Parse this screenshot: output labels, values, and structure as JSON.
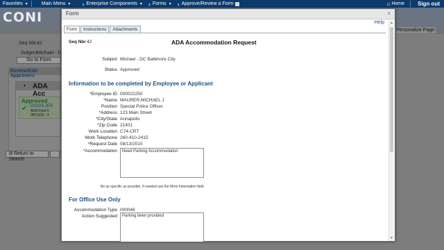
{
  "topnav": {
    "items": [
      "Favorites",
      "Main Menu",
      "Enterprise Components",
      "Forms",
      "Approve/Review a Form"
    ],
    "home": "Home",
    "signout": "Sign out"
  },
  "background": {
    "logo_text": "CONI",
    "seq_label": "Seq Nbr",
    "seq_value": "42",
    "subject_label": "Subject",
    "subject_value": "Michael - DC",
    "go_to_form": "Go to Form",
    "review_header": "Review/Edit Approvers",
    "card_title": "ADA Acc",
    "approved": "Approved",
    "approver_name": "DIGGS,JER",
    "approver_role": "ADA Field C",
    "approver_date": "08/13/15 - 4",
    "return_search": "Return to Search",
    "personalize": "Personalize Page"
  },
  "modal": {
    "title": "Form",
    "close": "×",
    "help": "Help",
    "tabs": [
      "Form",
      "Instructions",
      "Attachments"
    ],
    "seq_label": "Seq Nbr",
    "seq_value": "42",
    "form_title": "ADA Accommodation Request",
    "subject_label": "Subject",
    "subject_value": "Michael - DC Baltimore City",
    "status_label": "Status",
    "status_value": "Approved",
    "section1": "Information to be completed by Employee or Applicant",
    "fields": [
      {
        "label": "*Employee ID",
        "value": "000022250"
      },
      {
        "label": "*Name",
        "value": "MAURER,MICHAEL J"
      },
      {
        "label": "Position",
        "value": "Special Police Officer"
      },
      {
        "label": "*Address",
        "value": "123 Main Street"
      },
      {
        "label": "*City/State",
        "value": "Annapolis"
      },
      {
        "label": "*Zip Code",
        "value": "21401"
      },
      {
        "label": "Work Location",
        "value": "C74-CRT"
      },
      {
        "label": "Work Telephone",
        "value": "260-410-2415"
      },
      {
        "label": "*Request Date",
        "value": "08/13/2015"
      }
    ],
    "accommodation_label": "*Accommodation",
    "accommodation_value": "Need Parking Accommodation",
    "hint": "Be as specific as possible. If needed use the More Information field.",
    "section2": "For Office Use Only",
    "accommodation_type_label": "Accommodation Type",
    "accommodation_type_value": "000046",
    "action_label": "Action Suggested",
    "action_value": "Parking been provided"
  }
}
